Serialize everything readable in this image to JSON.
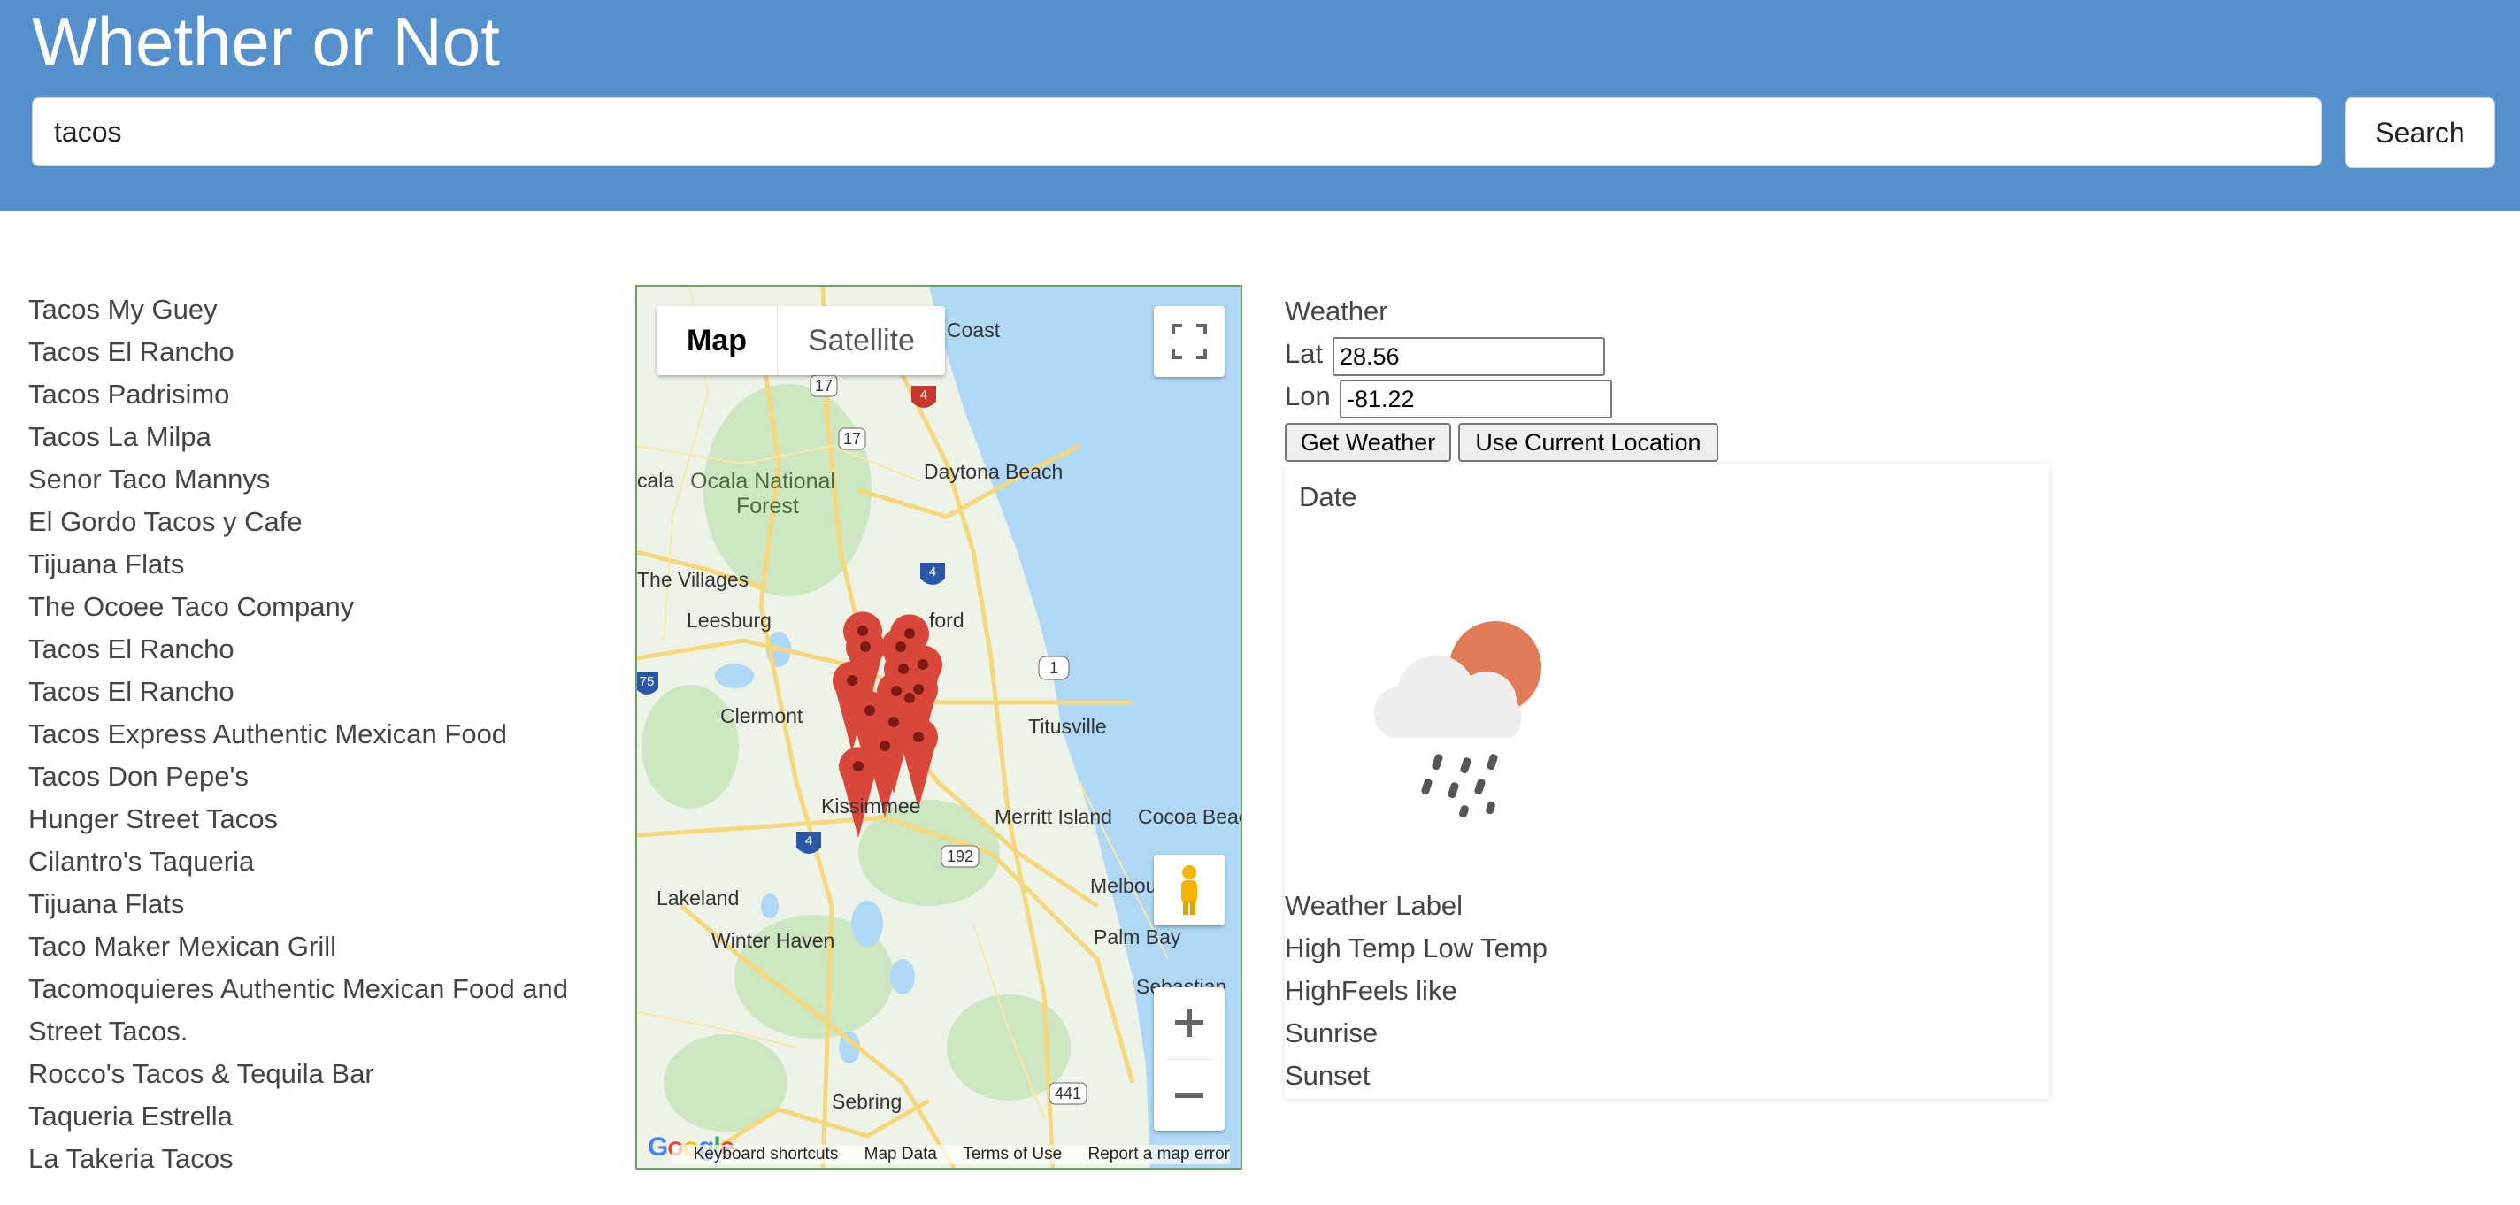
{
  "app": {
    "title": "Whether or Not"
  },
  "search": {
    "value": "tacos",
    "button_label": "Search"
  },
  "results": [
    "Tacos My Guey",
    "Tacos El Rancho",
    "Tacos Padrisimo",
    "Tacos La Milpa",
    "Senor Taco Mannys",
    "El Gordo Tacos y Cafe",
    "Tijuana Flats",
    "The Ocoee Taco Company",
    "Tacos El Rancho",
    "Tacos El Rancho",
    "Tacos Express Authentic Mexican Food",
    "Tacos Don Pepe's",
    "Hunger Street Tacos",
    "Cilantro's Taqueria",
    "Tijuana Flats",
    "Taco Maker Mexican Grill",
    "Tacomoquieres Authentic Mexican Food and",
    "Street Tacos.",
    "Rocco's Tacos & Tequila Bar",
    "Taqueria Estrella",
    "La Takeria Tacos"
  ],
  "map": {
    "type_map": "Map",
    "type_satellite": "Satellite",
    "places": {
      "coast": "Coast",
      "ocala_national_forest_1": "Ocala National",
      "ocala_national_forest_2": "Forest",
      "ocala": "cala",
      "daytona_beach": "Daytona Beach",
      "the_villages": "The Villages",
      "leesburg": "Leesburg",
      "sanford": "ford",
      "clermont": "Clermont",
      "titusville": "Titusville",
      "kissimmee": "Kissimmee",
      "merritt_island": "Merritt Island",
      "cocoa_beach": "Cocoa Beac",
      "lakeland": "Lakeland",
      "winter_haven": "Winter Haven",
      "melbourne": "Melbou",
      "palm_bay": "Palm Bay",
      "sebastian": "Sebastian",
      "sebring": "Sebring"
    },
    "shields": {
      "r17a": "17",
      "r17b": "17",
      "i4a": "4",
      "i4b": "4",
      "i75": "75",
      "us1": "1",
      "r192": "192",
      "r441": "441"
    },
    "footer": {
      "keyboard_shortcuts": "Keyboard shortcuts",
      "map_data": "Map Data",
      "terms": "Terms of Use",
      "report": "Report a map error"
    },
    "logo": "Google",
    "colors": {
      "water": "#aed8f5",
      "land": "#eef3e8",
      "green": "#cde7c2",
      "road": "#f6d77a",
      "marker": "#d9473b"
    }
  },
  "weather": {
    "heading": "Weather",
    "lat_label": "Lat",
    "lat_value": "28.56",
    "lon_label": "Lon",
    "lon_value": "-81.22",
    "get_weather_button": "Get Weather",
    "use_location_button": "Use Current Location",
    "card": {
      "date": "Date",
      "icon": "cloud-sun-rain-icon",
      "weather_label": "Weather Label",
      "temps": "High Temp Low Temp",
      "feels_like": "HighFeels like",
      "sunrise": "Sunrise",
      "sunset": "Sunset"
    }
  },
  "colors": {
    "header_bg": "#5490ce",
    "sun": "#e07a57",
    "cloud": "#eeeeee"
  }
}
